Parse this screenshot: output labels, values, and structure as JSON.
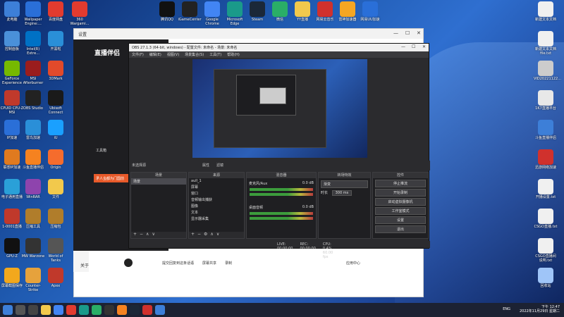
{
  "desktop": {
    "left_col1": [
      {
        "label": "此电脑",
        "color": "#3d7fd8"
      },
      {
        "label": "控制面板",
        "color": "#4a90d9"
      },
      {
        "label": "GeForce Experience",
        "color": "#76b900"
      },
      {
        "label": "CPUID CPU-Z MSI",
        "color": "#c0392b"
      },
      {
        "label": "IP加速",
        "color": "#2a6fd8"
      },
      {
        "label": "联想IP加速",
        "color": "#e07a1f"
      },
      {
        "label": "电子通用直播",
        "color": "#2aa0d8"
      },
      {
        "label": "1-0001直播",
        "color": "#c0392b"
      },
      {
        "label": "GPU-Z",
        "color": "#111111"
      },
      {
        "label": "屏幕截图保存",
        "color": "#f2a81d"
      }
    ],
    "left_col2": [
      {
        "label": "Wallpaper Engine:...",
        "color": "#2a6fd8"
      },
      {
        "label": "Intel(R) Extre...",
        "color": "#0071c5"
      },
      {
        "label": "MSI Afterburner",
        "color": "#9a1d1d"
      },
      {
        "label": "OBS Studio",
        "color": "#222222"
      },
      {
        "label": "雷鸟加速",
        "color": "#2a8fd8"
      },
      {
        "label": "斗鱼直播伴侣",
        "color": "#f58220"
      },
      {
        "label": "WinRAR",
        "color": "#8e44ad"
      },
      {
        "label": "压缩工具",
        "color": "#b07d2b"
      },
      {
        "label": "MW Warzone",
        "color": "#333333"
      },
      {
        "label": "Counter-Strike",
        "color": "#e6a23c"
      }
    ],
    "left_col3": [
      {
        "label": "百度网盘",
        "color": "#e33b2f"
      },
      {
        "label": "开黑啦",
        "color": "#2a8fd8"
      },
      {
        "label": "3DMark",
        "color": "#e24a2b"
      },
      {
        "label": "Ubisoft Connect",
        "color": "#1a1a1a"
      },
      {
        "label": "iU",
        "color": "#1aa0ff"
      },
      {
        "label": "Origin",
        "color": "#f56c2d"
      },
      {
        "label": "文件",
        "color": "#f2c94c"
      },
      {
        "label": "压缩包",
        "color": "#b07d2b"
      },
      {
        "label": "World of Tanks",
        "color": "#555555"
      },
      {
        "label": "Apex",
        "color": "#c0392b"
      }
    ],
    "left_col3_top": {
      "label": "360 Wargami...",
      "color": "#e33b2f"
    },
    "top_row": [
      {
        "label": "腾讯QQ",
        "color": "#111111"
      },
      {
        "label": "iGameCenter",
        "color": "#222222"
      },
      {
        "label": "Google Chrome",
        "color": "#4285f4"
      },
      {
        "label": "Microsoft Edge",
        "color": "#1a9a8a"
      },
      {
        "label": "Steam",
        "color": "#1b2838"
      },
      {
        "label": "微信",
        "color": "#2aae67"
      },
      {
        "label": "YY直播",
        "color": "#f2c94c"
      },
      {
        "label": "网易云音乐",
        "color": "#d0312d"
      },
      {
        "label": "雷神加速器",
        "color": "#f5a623"
      },
      {
        "label": "网易UU加速",
        "color": "#2a6fd8"
      }
    ],
    "right_col": [
      {
        "label": "新建文本文档",
        "color": "#f0f0f0"
      },
      {
        "label": "新建文本文档 file.txt",
        "color": "#f0f0f0"
      },
      {
        "label": "VID20221122...",
        "color": "#cccccc"
      },
      {
        "label": "1K7直播平台",
        "color": "#e8e8e8"
      },
      {
        "label": "斗鱼直播伴侣",
        "color": "#3d7fd8"
      },
      {
        "label": "迅游网络加速",
        "color": "#d0312d"
      },
      {
        "label": "开播设置.txt",
        "color": "#f0f0f0"
      },
      {
        "label": "CSGO直播.txt",
        "color": "#f0f0f0"
      },
      {
        "label": "CSGO直播间说明.txt",
        "color": "#f0f0f0"
      },
      {
        "label": "回收站",
        "color": "#9fc5f8"
      }
    ]
  },
  "bg_window": {
    "title": "设置",
    "app_logo": "直播伴侣",
    "side_items": [
      "新增",
      "互",
      "声",
      "D",
      "电",
      "功",
      "下",
      "播",
      "电",
      "文",
      "小",
      "关"
    ],
    "bottom_text": "关于",
    "red_button": "矛人虫都为门国前",
    "live_label": "工具箱"
  },
  "obs": {
    "title": "OBS 27.1.3 (64-bit, windows) - 配置文件: 未命名 - 场景: 未命名",
    "menu": [
      "文件(F)",
      "编辑(E)",
      "视图(V)",
      "场景集合(S)",
      "工具(T)",
      "帮助(H)"
    ],
    "scene_bar": [
      "未选择源",
      "属性",
      "滤镜"
    ],
    "panels": {
      "scenes": {
        "title": "场景",
        "items": [
          "场景"
        ]
      },
      "sources": {
        "title": "来源",
        "items": [
          "aull_1",
          "屏幕",
          "窗口",
          "音频输出捕获",
          "图像",
          "文本",
          "显示器采集"
        ]
      },
      "mixer": {
        "title": "混音器",
        "tracks": [
          {
            "name": "桌面音频",
            "level": "0.0 dB"
          },
          {
            "name": "麦克风/Aux",
            "level": "0.0 dB"
          }
        ]
      },
      "transitions": {
        "title": "转场特效",
        "type": "渐变",
        "duration_label": "时长",
        "duration": "300 ms"
      },
      "controls": {
        "title": "控件",
        "buttons": [
          "停止推流",
          "开始录制",
          "启动虚拟摄像机",
          "工作室模式",
          "设置",
          "退出"
        ]
      }
    },
    "status": [
      "LIVE: 00:00:00",
      "REC: 00:00:00",
      "CPU: 0.4%, 60.00 fps"
    ]
  },
  "chat_bar": {
    "items": [
      "提交回复",
      "提交回复到这条话语",
      "屏幕共享",
      "录制",
      "应用中心"
    ]
  },
  "taskbar": {
    "time": "下午 12:47",
    "date": "2022年11月29日 星期二",
    "lang": "ENG"
  }
}
